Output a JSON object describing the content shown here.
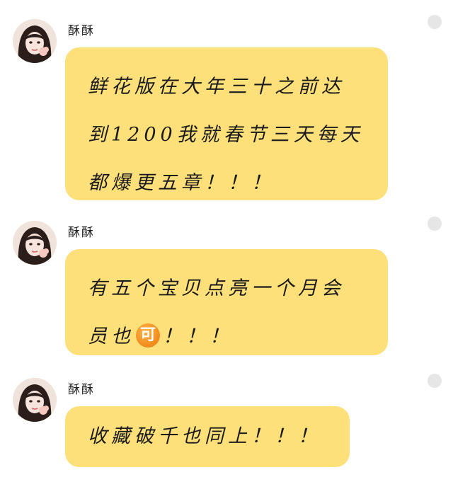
{
  "messages": [
    {
      "sender": "酥酥",
      "avatar": "avatar-girl",
      "lines": [
        "鲜花版在大年三十之前达",
        "到1200我就春节三天每天",
        "都爆更五章！！！"
      ]
    },
    {
      "sender": "酥酥",
      "avatar": "avatar-girl",
      "lines": [
        "有五个宝贝点亮一个月会",
        "员也"
      ],
      "emoji_text": "可",
      "line2_suffix": "！！！"
    },
    {
      "sender": "酥酥",
      "avatar": "avatar-girl",
      "lines": [
        "收藏破千也同上！！！"
      ]
    }
  ],
  "colors": {
    "bubble": "#fde07a",
    "status_dot": "#e6e6e6",
    "emoji_badge": "#f08a1c"
  }
}
